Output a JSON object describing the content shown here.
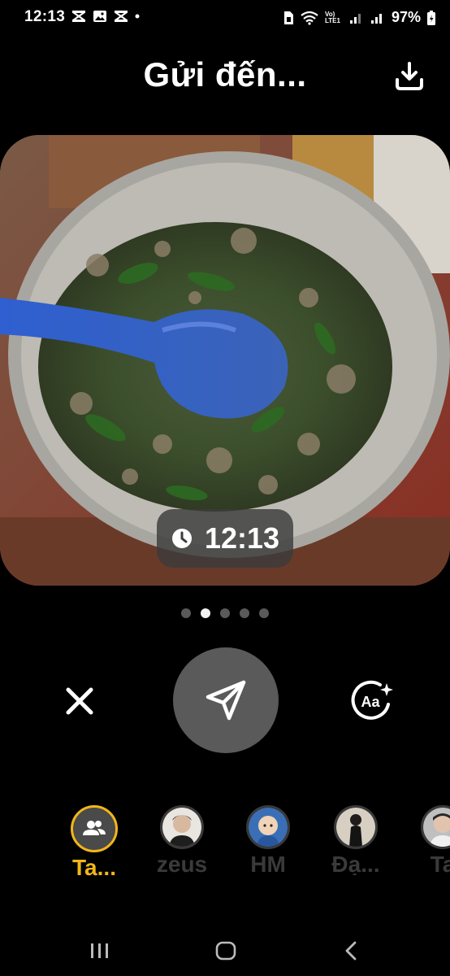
{
  "status_bar": {
    "time": "12:13",
    "battery": "97%",
    "network": "Vo) LTE1"
  },
  "header": {
    "title": "Gửi đến..."
  },
  "photo": {
    "timestamp": "12:13"
  },
  "pager": {
    "count": 5,
    "active_index": 1
  },
  "recipients": [
    {
      "name": "Ta...",
      "selected": true
    },
    {
      "name": "zeus",
      "selected": false
    },
    {
      "name": "HM",
      "selected": false
    },
    {
      "name": "Đạ...",
      "selected": false
    },
    {
      "name": "Ta",
      "selected": false
    }
  ],
  "colors": {
    "accent": "#f2b619",
    "background": "#000000",
    "button": "#5a5a5a"
  }
}
